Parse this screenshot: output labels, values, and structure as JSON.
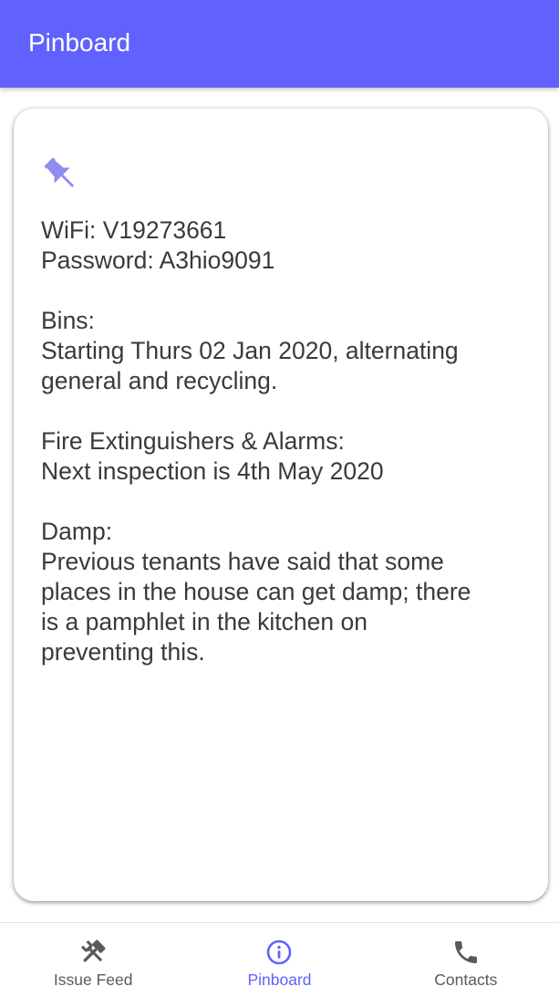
{
  "header": {
    "title": "Pinboard"
  },
  "colors": {
    "primary": "#6161fd",
    "pin": "#8c8cf2",
    "text": "#3a3a3a",
    "inactive": "#5a5a5a"
  },
  "note": {
    "icon": "pin-icon",
    "lines": [
      "WiFi: V19273661",
      "Password: A3hio9091",
      "",
      "Bins:",
      "Starting Thurs 02 Jan 2020, alternating",
      "general and recycling.",
      "",
      "Fire Extinguishers & Alarms:",
      "Next inspection is 4th May 2020",
      "",
      "Damp:",
      "Previous tenants have said that some",
      "places in the house can get damp; there",
      "is a pamphlet in the kitchen on",
      "preventing this."
    ]
  },
  "nav": {
    "items": [
      {
        "label": "Issue Feed",
        "icon": "tools-icon",
        "active": false
      },
      {
        "label": "Pinboard",
        "icon": "info-icon",
        "active": true
      },
      {
        "label": "Contacts",
        "icon": "phone-icon",
        "active": false
      }
    ]
  }
}
